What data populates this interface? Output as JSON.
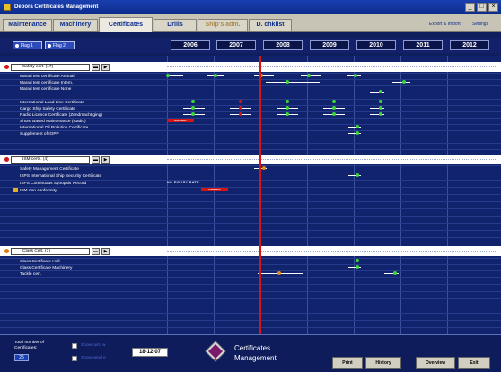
{
  "window": {
    "title": "Debora Certificates Management"
  },
  "tabs": [
    {
      "label": "Maintenance"
    },
    {
      "label": "Machinery"
    },
    {
      "label": "Certificates"
    },
    {
      "label": "Drills"
    },
    {
      "label": "Ship's adm."
    },
    {
      "label": "D. chklist"
    }
  ],
  "top_links": {
    "export": "Export & Import",
    "settings": "Settings"
  },
  "flags": {
    "flag1": "Flag 1",
    "flag2": "Flag 2"
  },
  "years": [
    "2006",
    "2007",
    "2008",
    "2009",
    "2010",
    "2011",
    "2012"
  ],
  "groups": [
    {
      "label": "Safety cert. (17)",
      "color": "#d41515"
    },
    {
      "label": "ISM certs. (4)",
      "color": "#d41515"
    },
    {
      "label": "Class Cert. (3)",
      "color": "#e07a10"
    }
  ],
  "safety_rows": [
    "Marad test certificate Annual",
    "Marad test certificate Intem.",
    "Marad test certificate None",
    "International Load Line Certificate",
    "Cargo Ship Safety Certificate",
    "Radio Licence Certificate (Zendmachtiging)",
    "Shore Based Maintenance (Radio)",
    "International Oil Pollution Certificate",
    "Supplement of IOPP"
  ],
  "ism_rows": [
    "Safety Management Certificate",
    "ISPS International Ship Security Certificate",
    "ISPS Continuous Synopsis Record",
    "ISM non conformity"
  ],
  "class_rows": [
    "Class Certificate Hull",
    "Class Certificate Machinery",
    "Tackle cert."
  ],
  "markers": {
    "expired": "EXPIRED",
    "no_expiry": "NO EXPIRY DATE"
  },
  "footer": {
    "total_label": "Total number of Certificates:",
    "total_value": "25",
    "show_cert_label": "Show cert. w",
    "show_send_label": "Show send e",
    "date": "18-12-07",
    "logo_text_1": "Certificates",
    "logo_text_2": "Management",
    "buttons": {
      "print": "Print",
      "history": "History",
      "overview": "Overview",
      "exit": "Exit"
    }
  },
  "colors": {
    "accent": "#0d2f8e",
    "today_line": "#d41515",
    "ok": "#3ad63a",
    "warn": "#e08a20",
    "expired": "#d41515"
  }
}
